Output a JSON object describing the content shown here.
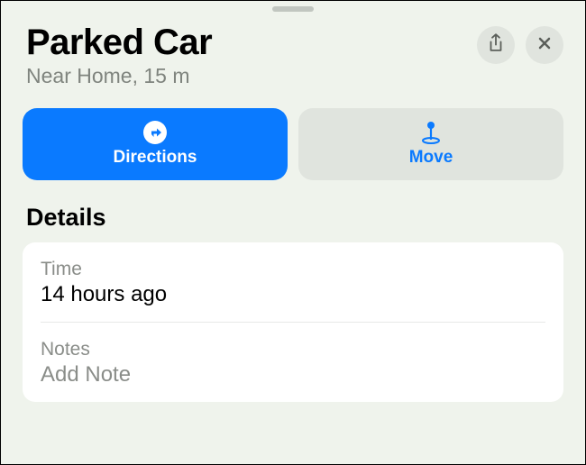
{
  "header": {
    "title": "Parked Car",
    "subtitle": "Near Home, 15 m"
  },
  "actions": {
    "directions_label": "Directions",
    "move_label": "Move"
  },
  "details": {
    "section_title": "Details",
    "time_label": "Time",
    "time_value": "14 hours ago",
    "notes_label": "Notes",
    "notes_placeholder": "Add Note"
  },
  "colors": {
    "accent": "#0a7aff",
    "background": "#eff3ec"
  }
}
